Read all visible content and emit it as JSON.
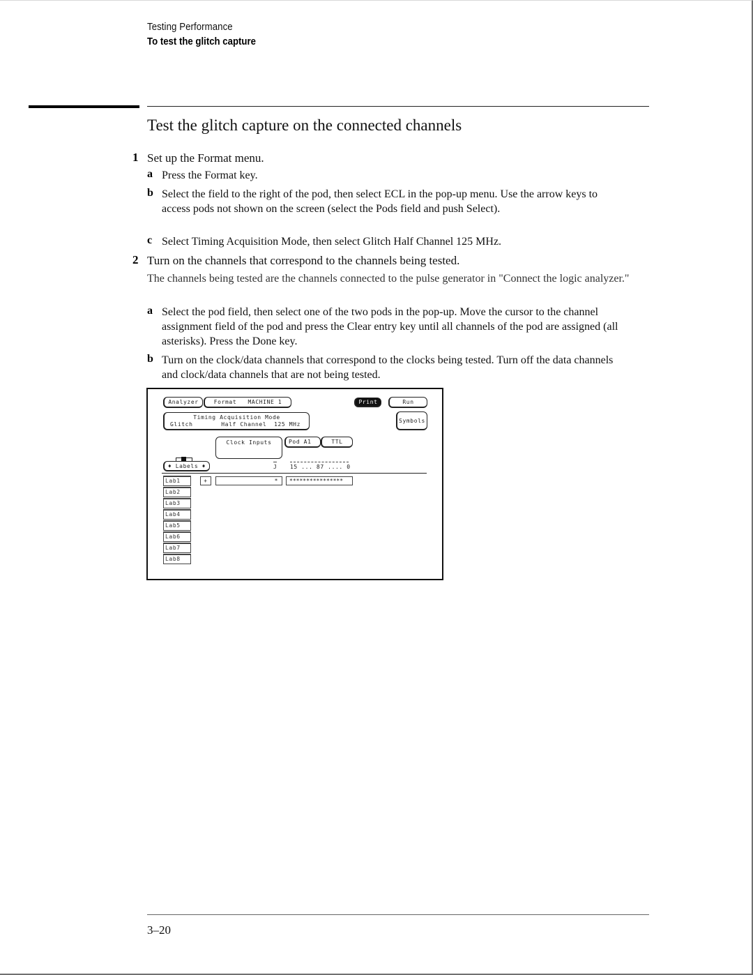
{
  "header": {
    "section": "Testing Performance",
    "subsection": "To test the glitch capture"
  },
  "title": "Test the glitch capture on the connected channels",
  "steps": [
    {
      "number": "1",
      "text": "Set up the Format menu.",
      "substeps": [
        {
          "letter": "a",
          "text": "Press the Format key."
        },
        {
          "letter": "b",
          "text": "Select the field to the right of the pod, then select ECL in the pop-up menu.  Use the arrow keys to access pods not shown on the screen (select the Pods field and push Select)."
        },
        {
          "letter": "c",
          "text": "Select Timing Acquisition Mode, then select Glitch Half Channel 125 MHz."
        }
      ]
    },
    {
      "number": "2",
      "text": "Turn on the channels that correspond to the channels being tested.",
      "paragraph": "The channels being tested are the channels connected to the pulse generator in \"Connect the logic analyzer.\"",
      "substeps": [
        {
          "letter": "a",
          "text": "Select the pod field, then select one of the two pods in the pop-up.  Move the cursor to the channel assignment field of the pod and press the Clear entry key until all channels of the pod are assigned (all asterisks).  Press the Done key."
        },
        {
          "letter": "b",
          "text": "Turn on the clock/data channels that correspond to the clocks being tested.  Turn off the data channels and clock/data channels that are not being tested."
        }
      ]
    }
  ],
  "screen": {
    "analyzer_button": "Analyzer",
    "format_button": "Format   MACHINE 1",
    "print_button": "Print",
    "run_button": "Run",
    "mode_title": "Timing Acquisition Mode",
    "mode_value_left": "Glitch",
    "mode_value_right": "Half Channel  125 MHz",
    "symbols_button": "Symbols",
    "clock_inputs": "Clock Inputs",
    "pod_button": "Pod A1",
    "threshold_button": "TTL",
    "labels_button": "♦ Labels ♦",
    "clock_header": "J",
    "bit_header": "15 ... 87 .... 0",
    "row1_polarity": "+",
    "row1_clock_field": "*",
    "row1_channels": "****************",
    "labels": [
      "Lab1",
      "Lab2",
      "Lab3",
      "Lab4",
      "Lab5",
      "Lab6",
      "Lab7",
      "Lab8"
    ]
  },
  "footer": {
    "page_number": "3–20"
  }
}
